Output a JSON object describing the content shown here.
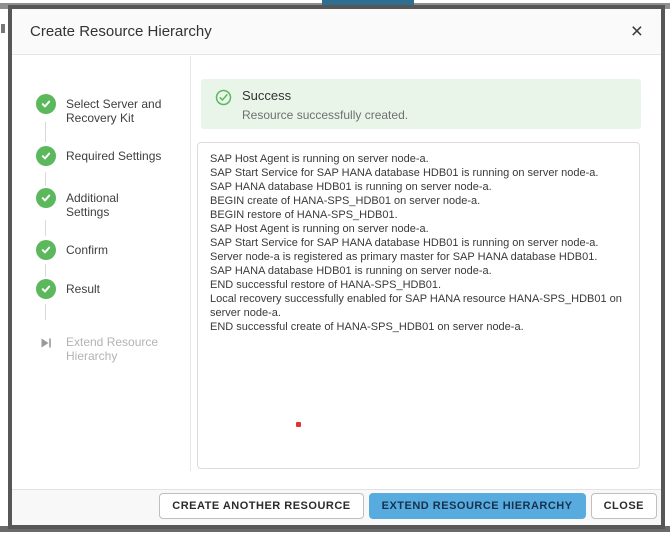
{
  "window": {
    "title": "Create Resource Hierarchy",
    "close_icon": "×"
  },
  "stepper": {
    "steps": [
      {
        "label": "Select Server and\nRecovery Kit",
        "state": "complete"
      },
      {
        "label": "Required Settings",
        "state": "complete"
      },
      {
        "label": "Additional\nSettings",
        "state": "complete"
      },
      {
        "label": "Confirm",
        "state": "complete"
      },
      {
        "label": "Result",
        "state": "complete"
      },
      {
        "label": "Extend Resource\nHierarchy",
        "state": "disabled"
      }
    ]
  },
  "result": {
    "status_title": "Success",
    "status_message": "Resource successfully created.",
    "log_lines": [
      "SAP Host Agent is running on server node-a.",
      "SAP Start Service for SAP HANA database HDB01 is running on server node-a.",
      "SAP HANA database HDB01 is running on server node-a.",
      "BEGIN create of HANA-SPS_HDB01 on server node-a.",
      "BEGIN restore of HANA-SPS_HDB01.",
      "SAP Host Agent is running on server node-a.",
      "SAP Start Service for SAP HANA database HDB01 is running on server node-a.",
      "Server node-a is registered as primary master for SAP HANA database HDB01.",
      "SAP HANA database HDB01 is running on server node-a.",
      "END successful restore of HANA-SPS_HDB01.",
      "Local recovery successfully enabled for SAP HANA resource HANA-SPS_HDB01 on server node-a.",
      "END successful create of HANA-SPS_HDB01 on server node-a."
    ]
  },
  "footer": {
    "buttons": [
      {
        "label": "CREATE ANOTHER RESOURCE",
        "style": "default"
      },
      {
        "label": "EXTEND RESOURCE HIERARCHY",
        "style": "primary"
      },
      {
        "label": "CLOSE",
        "style": "default"
      }
    ]
  },
  "colors": {
    "success_green": "#5cb85c",
    "success_banner_bg": "#eaf5ea",
    "primary_blue": "#58abdf",
    "modal_border": "#575757"
  }
}
